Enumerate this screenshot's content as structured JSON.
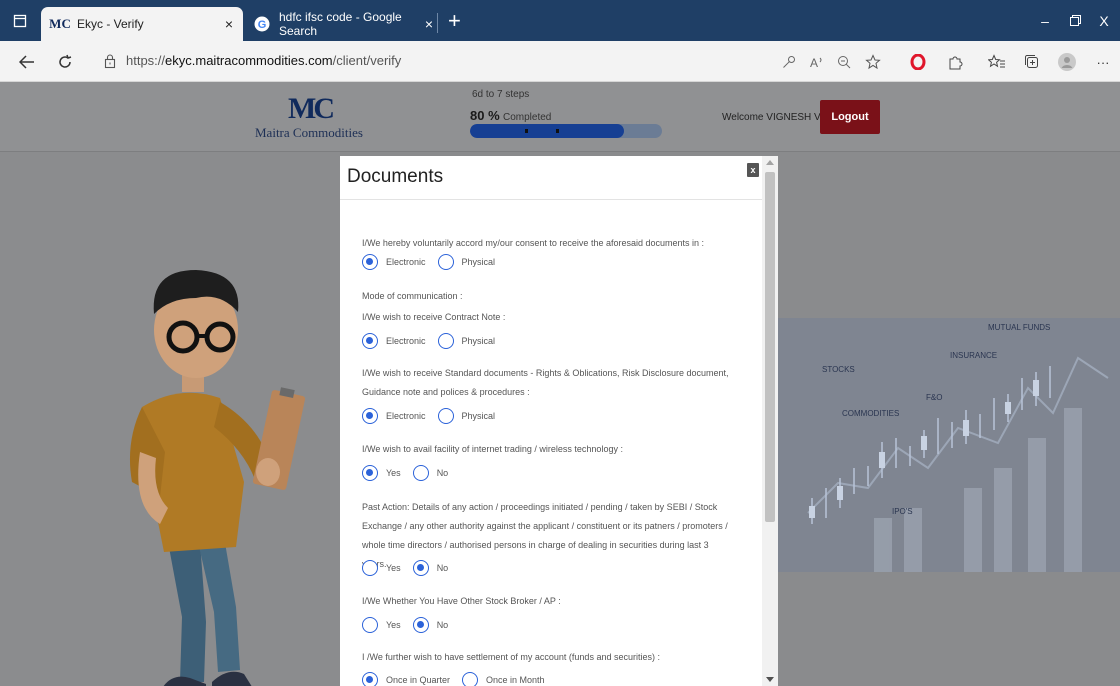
{
  "browser": {
    "tabs": [
      {
        "favicon": "MC",
        "title": "Ekyc - Verify",
        "close": "×"
      },
      {
        "favicon": "G",
        "title": "hdfc ifsc code - Google Search",
        "close": "×"
      }
    ],
    "new_tab": "+",
    "window_controls": {
      "minimize": "–",
      "restore": "▢",
      "close": "X"
    },
    "url_prefix": "https://",
    "url_host": "ekyc.maitracommodities.com",
    "url_path": "/client/verify",
    "more": "···"
  },
  "header": {
    "logo_mark": "MC",
    "logo_text": "Maitra Commodities",
    "steps_label": "6d to 7 steps",
    "progress_pct_value": "80 %",
    "progress_suffix": "Completed",
    "progress_fraction": 0.8,
    "welcome": "Welcome VIGNESH V",
    "logout": "Logout"
  },
  "background_chart_labels": [
    "MUTUAL FUNDS",
    "INSURANCE",
    "STOCKS",
    "F&O",
    "COMMODITIES",
    "IPO'S"
  ],
  "modal": {
    "title": "Documents",
    "close": "x",
    "questions": [
      {
        "text": "I/We hereby voluntarily accord my/our consent to receive the aforesaid documents in :",
        "options": [
          {
            "label": "Electronic",
            "checked": true
          },
          {
            "label": "Physical",
            "checked": false
          }
        ]
      },
      {
        "text": "Mode of communication :",
        "options": []
      },
      {
        "text": "I/We wish to receive Contract Note :",
        "options": [
          {
            "label": "Electronic",
            "checked": true
          },
          {
            "label": "Physical",
            "checked": false
          }
        ]
      },
      {
        "text": "I/We wish to receive Standard documents - Rights & Oblications, Risk Disclosure document, Guidance note and polices & procedures :",
        "options": [
          {
            "label": "Electronic",
            "checked": true
          },
          {
            "label": "Physical",
            "checked": false
          }
        ]
      },
      {
        "text": "I/We wish to avail facility of internet trading / wireless technology :",
        "options": [
          {
            "label": "Yes",
            "checked": true
          },
          {
            "label": "No",
            "checked": false
          }
        ]
      },
      {
        "text": "Past Action: Details of any action / proceedings initiated / pending / taken by SEBI / Stock Exchange / any other authority against the applicant / constituent or its patners / promoters / whole time directors / authorised persons in charge of dealing in securities during last 3 years.",
        "options": [
          {
            "label": "Yes",
            "checked": false
          },
          {
            "label": "No",
            "checked": true
          }
        ]
      },
      {
        "text": "I/We Whether You Have Other Stock Broker / AP :",
        "options": [
          {
            "label": "Yes",
            "checked": false
          },
          {
            "label": "No",
            "checked": true
          }
        ]
      },
      {
        "text": "I /We further wish to have settlement of my account (funds and securities) :",
        "options": [
          {
            "label": "Once in Quarter",
            "checked": true
          },
          {
            "label": "Once in Month",
            "checked": false
          }
        ]
      }
    ]
  }
}
